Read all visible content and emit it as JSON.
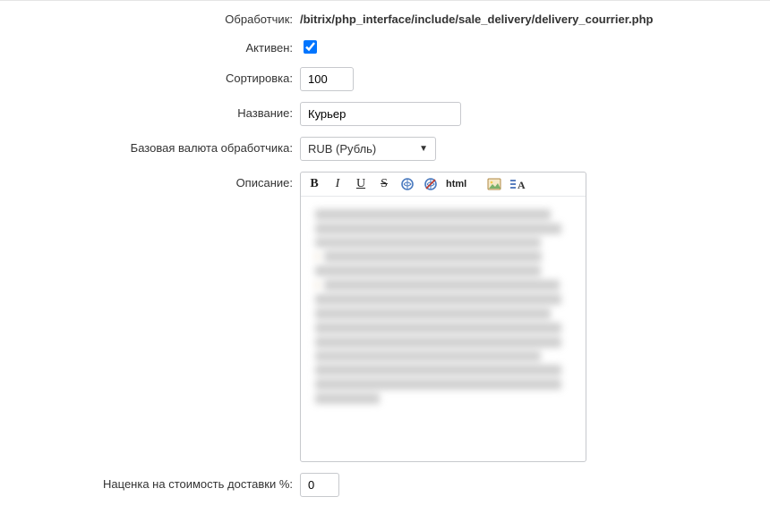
{
  "labels": {
    "handler": "Обработчик:",
    "active": "Активен:",
    "sort": "Сортировка:",
    "name": "Название:",
    "base_currency": "Базовая валюта обработчика:",
    "description": "Описание:",
    "markup": "Наценка на стоимость доставки %:"
  },
  "values": {
    "handler_path": "/bitrix/php_interface/include/sale_delivery/delivery_courrier.php",
    "active": true,
    "sort": "100",
    "name": "Курьер",
    "currency_display": "RUB (Рубль)",
    "markup": "0"
  },
  "toolbar": {
    "bold": "B",
    "italic": "I",
    "underline": "U",
    "strike": "S",
    "html": "html"
  },
  "icon_names": {
    "link": "link-icon",
    "unlink": "unlink-icon",
    "image": "image-icon",
    "text_direction": "text-direction-icon",
    "dropdown": "chevron-down-icon"
  }
}
